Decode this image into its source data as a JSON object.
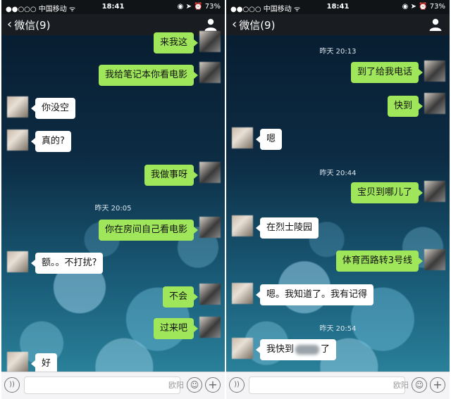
{
  "statusbar": {
    "carrier": "●●○○○ 中国移动 ᯤ",
    "time": "18:41",
    "right": "◉ ➤ ⏰ 73%"
  },
  "nav": {
    "back_label": "微信(9)"
  },
  "left": {
    "msgs": [
      "来我这",
      "我给笔记本你看电影",
      "你没空",
      "真的?",
      "我做事呀",
      "你在房间自己看电影",
      "额。。不打扰?",
      "不会",
      "过来吧",
      "好"
    ],
    "ts1": "昨天 20:05"
  },
  "right": {
    "ts1": "昨天 20:13",
    "ts2": "昨天 20:44",
    "ts3": "昨天 20:54",
    "msgs": [
      "到了给我电话",
      "快到",
      "嗯",
      "宝贝到哪儿了",
      "在烈士陵园",
      "体育西路转3号线",
      "嗯。我知道了。我有记得",
      "我快到",
      "了"
    ]
  },
  "watermark": "欧阳"
}
